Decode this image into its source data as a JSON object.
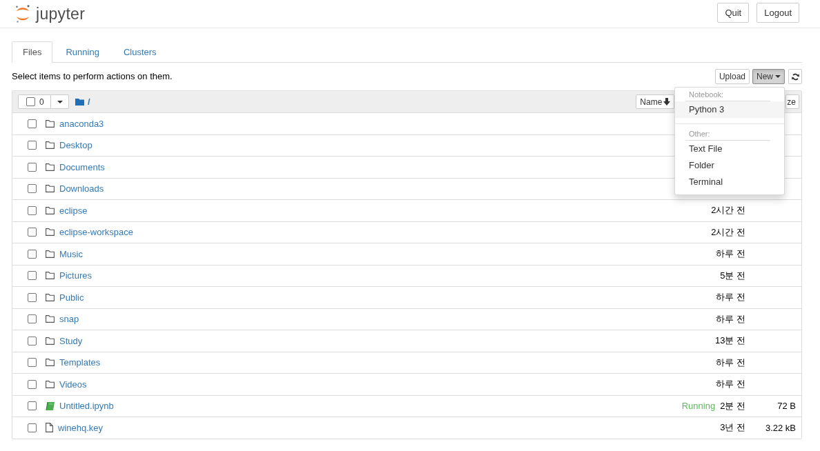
{
  "header": {
    "logo_text": "jupyter",
    "buttons": [
      "Quit",
      "Logout"
    ]
  },
  "tabs": [
    {
      "label": "Files",
      "selected": true
    },
    {
      "label": "Running",
      "selected": false
    },
    {
      "label": "Clusters",
      "selected": false
    }
  ],
  "toolbar": {
    "hint": "Select items to perform actions on them.",
    "upload_button": "Upload",
    "new_button": {
      "label": "New",
      "expanded": true
    }
  },
  "new_menu": [
    {
      "heading": "Notebook:",
      "items": [
        {
          "label": "Python 3",
          "selected": true
        }
      ]
    },
    {
      "heading": "Other:",
      "items": [
        {
          "label": "Text File",
          "selected": false
        },
        {
          "label": "Folder",
          "selected": false
        },
        {
          "label": "Terminal",
          "selected": false
        }
      ]
    }
  ],
  "file_list": {
    "select_all": {
      "checked": false,
      "count": "0"
    },
    "path": "/",
    "sort_buttons": [
      {
        "label": "Name",
        "sorted": true
      },
      {
        "label": "ze",
        "sorted": false
      }
    ],
    "rows": [
      {
        "kind": "folder",
        "name": "anaconda3",
        "checked": false
      },
      {
        "kind": "folder",
        "name": "Desktop",
        "checked": false
      },
      {
        "kind": "folder",
        "name": "Documents",
        "checked": false
      },
      {
        "kind": "folder",
        "name": "Downloads",
        "checked": false
      },
      {
        "kind": "folder",
        "name": "eclipse",
        "checked": false,
        "modified": "2시간 전"
      },
      {
        "kind": "folder",
        "name": "eclipse-workspace",
        "checked": false,
        "modified": "2시간 전"
      },
      {
        "kind": "folder",
        "name": "Music",
        "checked": false,
        "modified": "하루 전"
      },
      {
        "kind": "folder",
        "name": "Pictures",
        "checked": false,
        "modified": "5분 전"
      },
      {
        "kind": "folder",
        "name": "Public",
        "checked": false,
        "modified": "하루 전"
      },
      {
        "kind": "folder",
        "name": "snap",
        "checked": false,
        "modified": "하루 전"
      },
      {
        "kind": "folder",
        "name": "Study",
        "checked": false,
        "modified": "13분 전"
      },
      {
        "kind": "folder",
        "name": "Templates",
        "checked": false,
        "modified": "하루 전"
      },
      {
        "kind": "folder",
        "name": "Videos",
        "checked": false,
        "modified": "하루 전"
      },
      {
        "kind": "notebook",
        "name": "Untitled.ipynb",
        "checked": false,
        "running": "Running",
        "modified": "2분 전",
        "size": "72 B"
      },
      {
        "kind": "file",
        "name": "winehq.key",
        "checked": false,
        "modified": "3년 전",
        "size": "3.22 kB"
      }
    ]
  }
}
